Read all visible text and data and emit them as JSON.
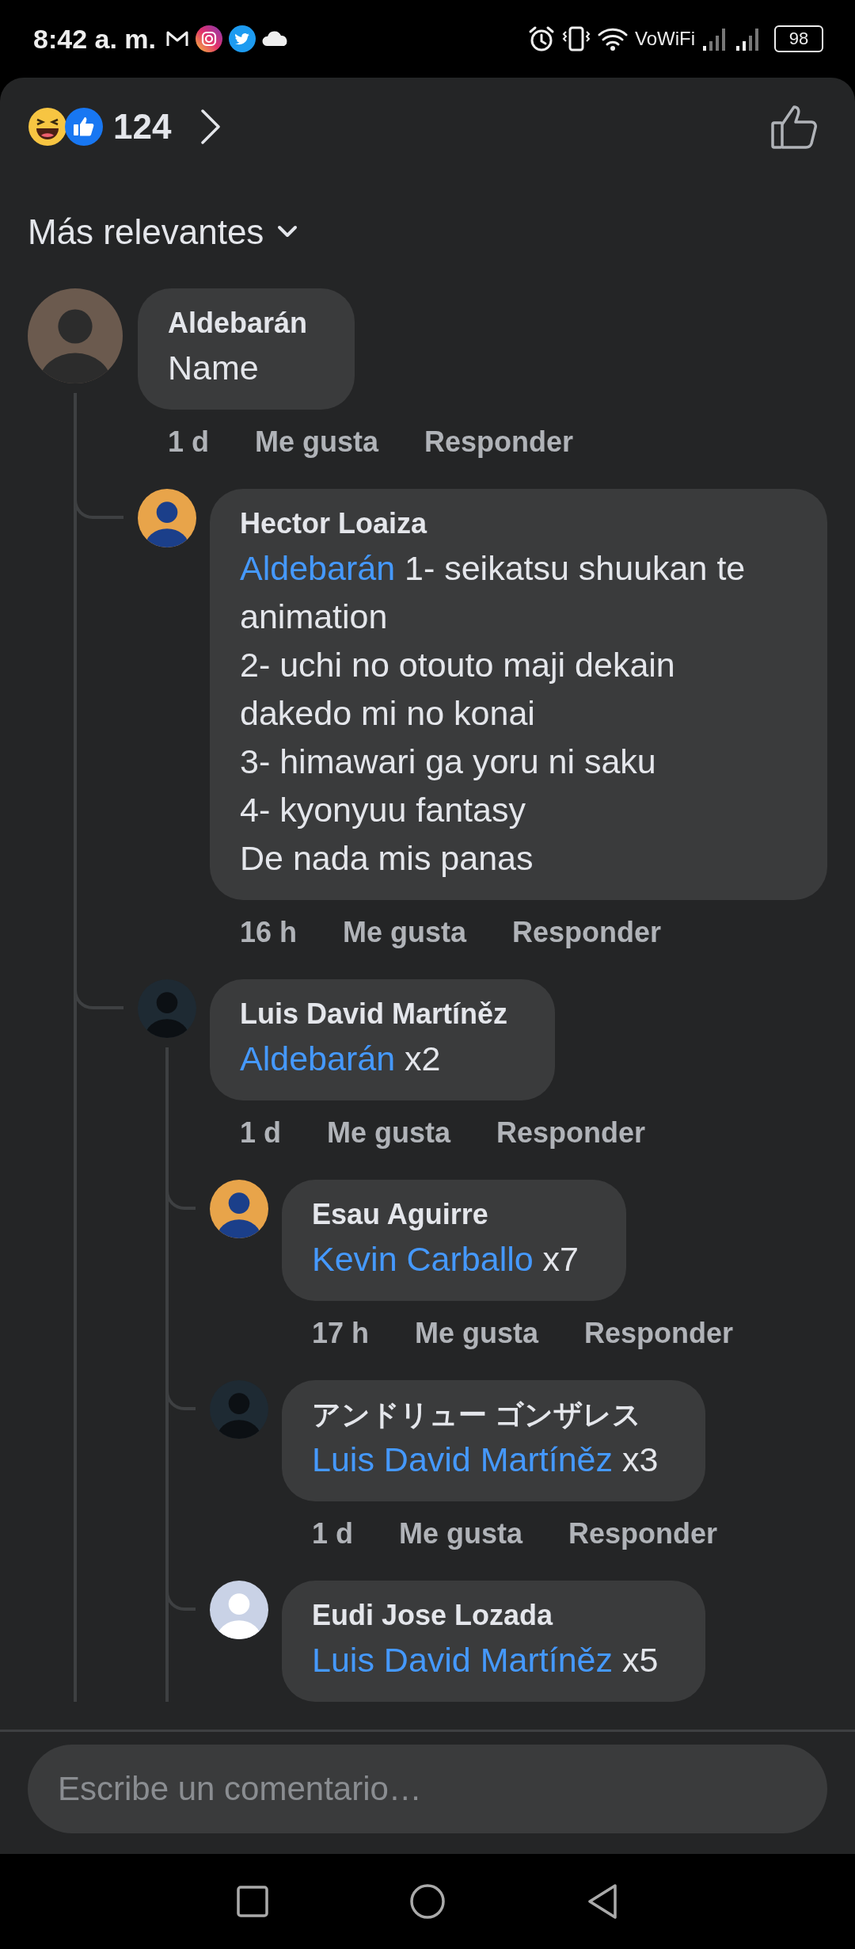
{
  "status_bar": {
    "time": "8:42 a. m.",
    "network_label": "VoWiFi",
    "battery": "98"
  },
  "reactions": {
    "count": "124"
  },
  "sort": {
    "label": "Más relevantes"
  },
  "comments": [
    {
      "author": "Aldebarán",
      "text": "Name",
      "time": "1 d",
      "like_label": "Me gusta",
      "reply_label": "Responder",
      "replies": [
        {
          "author": "Hector Loaiza",
          "mention": "Aldebarán",
          "text": "1- seikatsu shuukan te animation\n2- uchi no otouto maji dekain dakedo mi no konai\n3- himawari ga yoru ni saku\n4- kyonyuu fantasy\nDe nada mis panas",
          "time": "16 h",
          "like_label": "Me gusta",
          "reply_label": "Responder"
        },
        {
          "author": "Luis David Martíněz",
          "mention": "Aldebarán",
          "text": "x2",
          "time": "1 d",
          "like_label": "Me gusta",
          "reply_label": "Responder",
          "replies": [
            {
              "author": "Esau Aguirre",
              "mention": "Kevin Carballo",
              "text": "x7",
              "time": "17 h",
              "like_label": "Me gusta",
              "reply_label": "Responder"
            },
            {
              "author": "アンドリュー ゴンザレス",
              "mention": "Luis David Martíněz",
              "text": "x3",
              "time": "1 d",
              "like_label": "Me gusta",
              "reply_label": "Responder"
            },
            {
              "author": "Eudi Jose Lozada",
              "mention": "Luis David Martíněz",
              "text": "x5"
            }
          ]
        }
      ]
    }
  ],
  "composer": {
    "placeholder": "Escribe un comentario…"
  }
}
